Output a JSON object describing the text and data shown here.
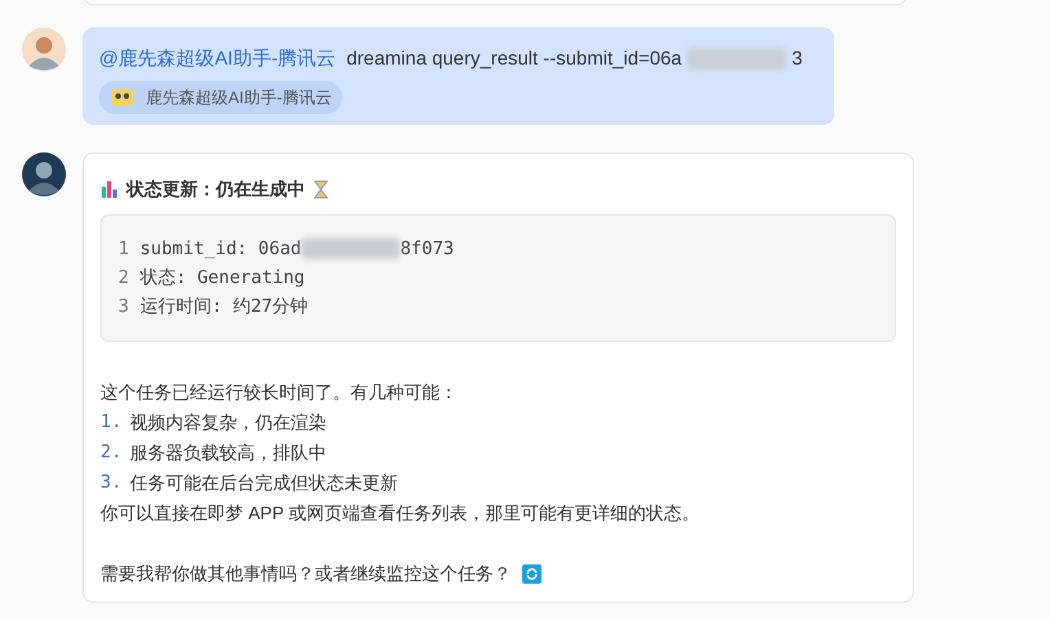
{
  "user_message": {
    "mention": "@鹿先森超级AI助手-腾讯云",
    "text_before_redaction": "dreamina query_result --submit_id=06a",
    "text_after_redaction": "3",
    "chip": "鹿先森超级AI助手-腾讯云"
  },
  "bot_message": {
    "title": "状态更新：仍在生成中",
    "code_lines": [
      {
        "number": "1",
        "before_redaction": "submit_id: 06ad",
        "after_redaction": "8f073",
        "redacted": true
      },
      {
        "number": "2",
        "before_redaction": "状态: Generating",
        "redacted": false
      },
      {
        "number": "3",
        "before_redaction": "运行时间: 约27分钟",
        "redacted": false
      }
    ],
    "intro": "这个任务已经运行较长时间了。有几种可能：",
    "list": [
      {
        "marker": "1.",
        "text": "视频内容复杂，仍在渲染"
      },
      {
        "marker": "2.",
        "text": "服务器负载较高，排队中"
      },
      {
        "marker": "3.",
        "text": "任务可能在后台完成但状态未更新"
      }
    ],
    "note": "你可以直接在即梦 APP 或网页端查看任务列表，那里可能有更详细的状态。",
    "question": "需要我帮你做其他事情吗？或者继续监控这个任务？"
  }
}
